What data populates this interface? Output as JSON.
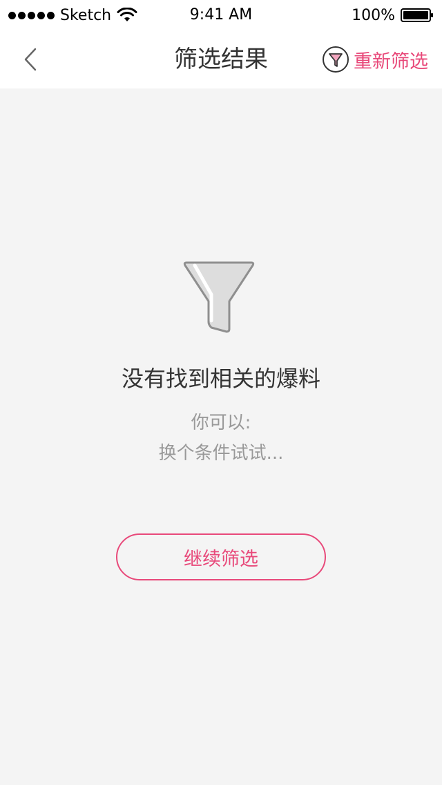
{
  "status_bar": {
    "carrier": "Sketch",
    "time": "9:41 AM",
    "battery": "100%"
  },
  "nav": {
    "title": "筛选结果",
    "back_icon": "chevron-left-icon",
    "refilter_label": "重新筛选",
    "refilter_icon": "filter-icon"
  },
  "empty_state": {
    "icon": "funnel-icon",
    "title": "没有找到相关的爆料",
    "hint_line1": "你可以:",
    "hint_line2": "换个条件试试..."
  },
  "actions": {
    "continue_label": "继续筛选"
  },
  "colors": {
    "accent": "#e8497a",
    "background": "#f4f4f4",
    "header": "#ffffff"
  }
}
